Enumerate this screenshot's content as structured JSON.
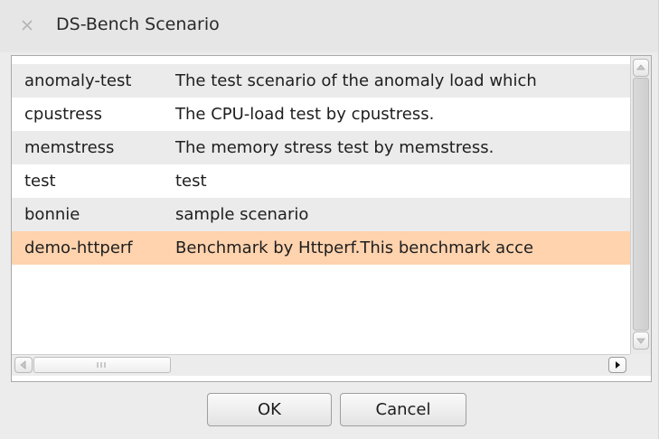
{
  "window": {
    "title": "DS-Bench Scenario",
    "close_icon": "close-icon"
  },
  "scenarios": [
    {
      "name": "anomaly-test",
      "description": "The test scenario of the anomaly load which"
    },
    {
      "name": "cpustress",
      "description": "The CPU-load test by cpustress."
    },
    {
      "name": "memstress",
      "description": "The memory stress test by memstress."
    },
    {
      "name": "test",
      "description": "test"
    },
    {
      "name": "bonnie",
      "description": "sample scenario"
    },
    {
      "name": "demo-httperf",
      "description": "Benchmark by Httperf.This benchmark acce"
    }
  ],
  "selected_index": 5,
  "colors": {
    "selected_row": "#ffd3ae",
    "alt_row": "#ebebeb"
  },
  "buttons": {
    "ok": "OK",
    "cancel": "Cancel"
  }
}
